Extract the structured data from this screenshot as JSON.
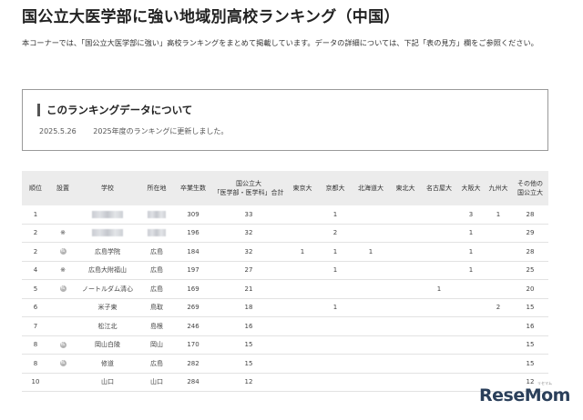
{
  "page": {
    "title": "国公立大医学部に強い地域別高校ランキング（中国）",
    "intro": "本コーナーでは、「国公立大医学部に強い」高校ランキングをまとめて掲載しています。データの詳細については、下記「表の見方」欄をご参照ください。"
  },
  "info": {
    "heading": "このランキングデータについて",
    "date": "2025.5.26",
    "text": "2025年度のランキングに更新しました。"
  },
  "table": {
    "headers": {
      "rank": "順位",
      "established": "設置",
      "school": "学校",
      "location": "所在地",
      "grads": "卒業生数",
      "total_line1": "国公立大",
      "total_line2": "「医学部・医学科」合計",
      "tokyo": "東京大",
      "kyoto": "京都大",
      "hokkaido": "北海道大",
      "tohoku": "東北大",
      "nagoya": "名古屋大",
      "osaka": "大阪大",
      "kyushu": "九州大",
      "other_line1": "その他の",
      "other_line2": "国公立大"
    },
    "rows": [
      {
        "rank": "1",
        "established": "",
        "school": "",
        "location": "",
        "grads": "309",
        "total": "33",
        "tokyo": "",
        "kyoto": "1",
        "hokkaido": "",
        "tohoku": "",
        "nagoya": "",
        "osaka": "3",
        "kyushu": "1",
        "other": "28"
      },
      {
        "rank": "2",
        "established": "※",
        "school": "",
        "location": "",
        "grads": "196",
        "total": "32",
        "tokyo": "",
        "kyoto": "2",
        "hokkaido": "",
        "tohoku": "",
        "nagoya": "",
        "osaka": "1",
        "kyushu": "",
        "other": "29"
      },
      {
        "rank": "2",
        "established": "私",
        "school": "広島学院",
        "location": "広島",
        "grads": "184",
        "total": "32",
        "tokyo": "1",
        "kyoto": "1",
        "hokkaido": "1",
        "tohoku": "",
        "nagoya": "",
        "osaka": "1",
        "kyushu": "",
        "other": "28"
      },
      {
        "rank": "4",
        "established": "※",
        "school": "広島大附福山",
        "location": "広島",
        "grads": "197",
        "total": "27",
        "tokyo": "",
        "kyoto": "1",
        "hokkaido": "",
        "tohoku": "",
        "nagoya": "",
        "osaka": "1",
        "kyushu": "",
        "other": "25"
      },
      {
        "rank": "5",
        "established": "私",
        "school": "ノートルダム清心",
        "location": "広島",
        "grads": "169",
        "total": "21",
        "tokyo": "",
        "kyoto": "",
        "hokkaido": "",
        "tohoku": "",
        "nagoya": "1",
        "osaka": "",
        "kyushu": "",
        "other": "20"
      },
      {
        "rank": "6",
        "established": "",
        "school": "米子東",
        "location": "鳥取",
        "grads": "269",
        "total": "18",
        "tokyo": "",
        "kyoto": "1",
        "hokkaido": "",
        "tohoku": "",
        "nagoya": "",
        "osaka": "",
        "kyushu": "2",
        "other": "15"
      },
      {
        "rank": "7",
        "established": "",
        "school": "松江北",
        "location": "島根",
        "grads": "246",
        "total": "16",
        "tokyo": "",
        "kyoto": "",
        "hokkaido": "",
        "tohoku": "",
        "nagoya": "",
        "osaka": "",
        "kyushu": "",
        "other": "16"
      },
      {
        "rank": "8",
        "established": "私",
        "school": "岡山白陵",
        "location": "岡山",
        "grads": "170",
        "total": "15",
        "tokyo": "",
        "kyoto": "",
        "hokkaido": "",
        "tohoku": "",
        "nagoya": "",
        "osaka": "",
        "kyushu": "",
        "other": "15"
      },
      {
        "rank": "8",
        "established": "私",
        "school": "修道",
        "location": "広島",
        "grads": "282",
        "total": "15",
        "tokyo": "",
        "kyoto": "",
        "hokkaido": "",
        "tohoku": "",
        "nagoya": "",
        "osaka": "",
        "kyushu": "",
        "other": "15"
      },
      {
        "rank": "10",
        "established": "",
        "school": "山口",
        "location": "山口",
        "grads": "284",
        "total": "12",
        "tokyo": "",
        "kyoto": "",
        "hokkaido": "",
        "tohoku": "",
        "nagoya": "",
        "osaka": "",
        "kyushu": "",
        "other": "12"
      }
    ]
  },
  "logo": {
    "text": "ReseMom",
    "sub": "リセマム"
  }
}
